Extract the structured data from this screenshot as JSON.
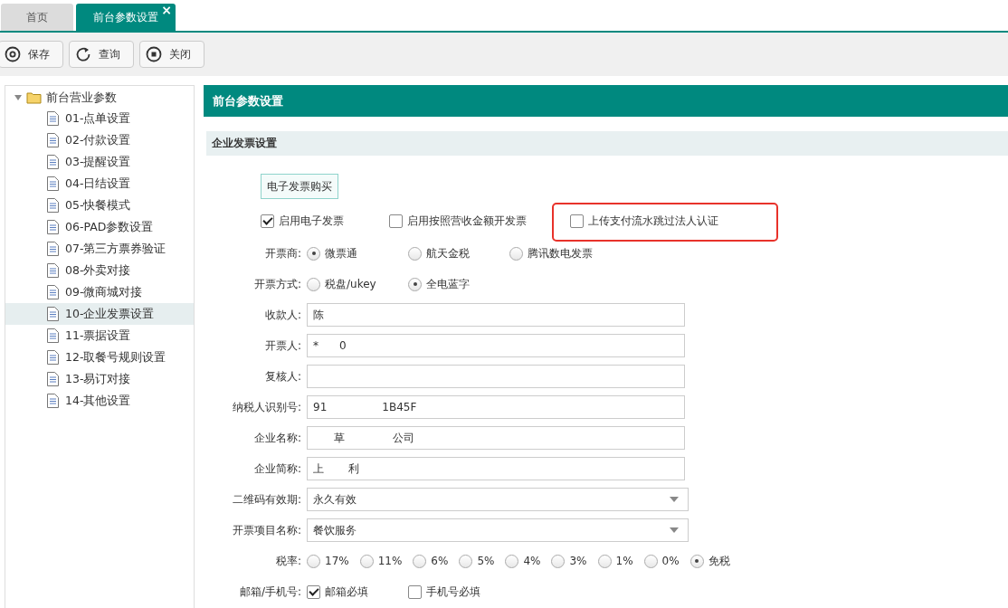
{
  "tabs": [
    {
      "label": "首页",
      "selected": false
    },
    {
      "label": "前台参数设置",
      "selected": true,
      "close_glyph": "×"
    }
  ],
  "toolbar": [
    {
      "label": "保存",
      "kind": "save"
    },
    {
      "label": "查询",
      "kind": "refresh"
    },
    {
      "label": "关闭",
      "kind": "close"
    }
  ],
  "tree": {
    "label": "前台营业参数",
    "expanded": true,
    "children": [
      {
        "label": "01-点单设置",
        "selected": false
      },
      {
        "label": "02-付款设置",
        "selected": false
      },
      {
        "label": "03-提醒设置",
        "selected": false
      },
      {
        "label": "04-日结设置",
        "selected": false
      },
      {
        "label": "05-快餐模式",
        "selected": false
      },
      {
        "label": "06-PAD参数设置",
        "selected": false
      },
      {
        "label": "07-第三方票券验证",
        "selected": false
      },
      {
        "label": "08-外卖对接",
        "selected": false
      },
      {
        "label": "09-微商城对接",
        "selected": false
      },
      {
        "label": "10-企业发票设置",
        "selected": true
      },
      {
        "label": "11-票据设置",
        "selected": false
      },
      {
        "label": "12-取餐号规则设置",
        "selected": false
      },
      {
        "label": "13-易订对接",
        "selected": false
      },
      {
        "label": "14-其他设置",
        "selected": false
      }
    ]
  },
  "panel": {
    "title": "前台参数设置",
    "section": "企业发票设置",
    "purchase_button": "电子发票购买",
    "checkboxes": [
      {
        "label": "启用电子发票",
        "checked": true,
        "highlighted": false
      },
      {
        "label": "启用按照营收金额开发票",
        "checked": false,
        "highlighted": false
      },
      {
        "label": "上传支付流水跳过法人认证",
        "checked": false,
        "highlighted": true
      }
    ],
    "rows": [
      {
        "kind": "radio",
        "label": "开票商:",
        "options": [
          {
            "label": "微票通",
            "selected": true
          },
          {
            "label": "航天金税",
            "selected": false
          },
          {
            "label": "腾讯数电发票",
            "selected": false
          }
        ]
      },
      {
        "kind": "radio",
        "label": "开票方式:",
        "options": [
          {
            "label": "税盘/ukey",
            "selected": false
          },
          {
            "label": "全电蓝字",
            "selected": true
          }
        ]
      },
      {
        "kind": "input",
        "label": "收款人:",
        "value": "陈"
      },
      {
        "kind": "input",
        "label": "开票人:",
        "value": "*      0"
      },
      {
        "kind": "input",
        "label": "复核人:"
      },
      {
        "kind": "input",
        "label": "纳税人识别号:",
        "value": "91                1B45F"
      },
      {
        "kind": "input",
        "label": "企业名称:",
        "value": "      草              公司"
      },
      {
        "kind": "input",
        "label": "企业简称:",
        "value": "上       利"
      },
      {
        "kind": "select",
        "label": "二维码有效期:",
        "value": "永久有效"
      },
      {
        "kind": "select",
        "label": "开票项目名称:",
        "value": "餐饮服务"
      },
      {
        "kind": "radio",
        "label": "税率:",
        "options": [
          {
            "label": "17%",
            "selected": false
          },
          {
            "label": "11%",
            "selected": false
          },
          {
            "label": "6%",
            "selected": false
          },
          {
            "label": "5%",
            "selected": false
          },
          {
            "label": "4%",
            "selected": false
          },
          {
            "label": "3%",
            "selected": false
          },
          {
            "label": "1%",
            "selected": false
          },
          {
            "label": "0%",
            "selected": false
          },
          {
            "label": "免税",
            "selected": true
          }
        ]
      },
      {
        "kind": "check",
        "label": "邮箱/手机号:",
        "options": [
          {
            "label": "邮箱必填",
            "checked": true
          },
          {
            "label": "手机号必填",
            "checked": false
          }
        ]
      }
    ]
  }
}
